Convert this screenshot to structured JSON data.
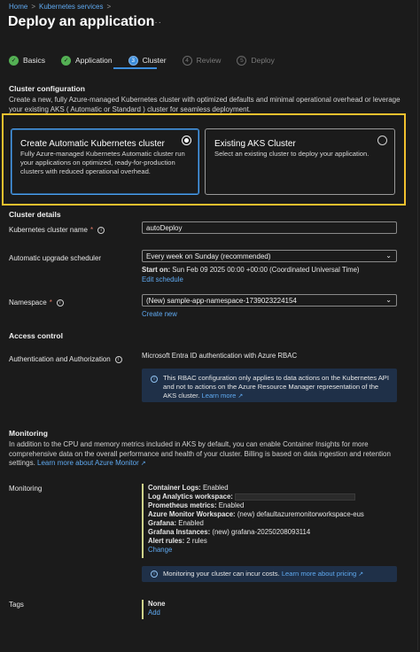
{
  "breadcrumb": {
    "home": "Home",
    "services": "Kubernetes services",
    "sep": ">"
  },
  "title": "Deploy an application",
  "more_icon": "···",
  "steps": [
    {
      "num": "✓",
      "label": "Basics",
      "state": "done"
    },
    {
      "num": "✓",
      "label": "Application",
      "state": "done"
    },
    {
      "num": "3",
      "label": "Cluster",
      "state": "active"
    },
    {
      "num": "4",
      "label": "Review",
      "state": "todo"
    },
    {
      "num": "5",
      "label": "Deploy",
      "state": "todo"
    }
  ],
  "cluster_config": {
    "heading": "Cluster configuration",
    "description": "Create a new, fully Azure-managed Kubernetes cluster with optimized defaults and minimal operational overhead or leverage your existing AKS ( Automatic or Standard ) cluster for seamless deployment.",
    "option_automatic": {
      "title": "Create Automatic Kubernetes cluster",
      "desc": "Fully Azure-managed Kubernetes Automatic cluster run your applications on optimized, ready-for-production clusters with reduced operational overhead."
    },
    "option_existing": {
      "title": "Existing AKS Cluster",
      "desc": "Select an existing cluster to deploy your application."
    }
  },
  "cluster_details": {
    "heading": "Cluster details",
    "name_label": "Kubernetes cluster name",
    "required_mark": "*",
    "name_value": "autoDeploy",
    "upgrade_label": "Automatic upgrade scheduler",
    "upgrade_value": "Every week on Sunday (recommended)",
    "start_on_label": "Start on:",
    "start_on_value": "Sun Feb 09 2025 00:00 +00:00 (Coordinated Universal Time)",
    "edit_schedule": "Edit schedule",
    "namespace_label": "Namespace",
    "namespace_value": "(New) sample-app-namespace-1739023224154",
    "create_new": "Create new"
  },
  "access_control": {
    "heading": "Access control",
    "auth_label": "Authentication and Authorization",
    "auth_value": "Microsoft Entra ID authentication with Azure RBAC",
    "info_text": "This RBAC configuration only applies to data actions on the Kubernetes API and not to actions on the Azure Resource Manager representation of the AKS cluster.",
    "learn_more": "Learn more"
  },
  "monitoring": {
    "heading": "Monitoring",
    "description": "In addition to the CPU and memory metrics included in AKS by default, you can enable Container Insights for more comprehensive data on the overall performance and health of your cluster. Billing is based on data ingestion and retention settings.",
    "learn_more": "Learn more about Azure Monitor",
    "label": "Monitoring",
    "items": [
      {
        "k": "Container Logs:",
        "v": "Enabled"
      },
      {
        "k": "Log Analytics workspace:",
        "v": ""
      },
      {
        "k": "Prometheus metrics:",
        "v": "Enabled"
      },
      {
        "k": "Azure Monitor Workspace:",
        "v": "(new) defaultazuremonitorworkspace-eus"
      },
      {
        "k": "Grafana:",
        "v": "Enabled"
      },
      {
        "k": "Grafana Instances:",
        "v": "(new) grafana-20250208093114"
      },
      {
        "k": "Alert rules:",
        "v": "2 rules"
      }
    ],
    "change": "Change",
    "cost_note": "Monitoring your cluster can incur costs.",
    "cost_link": "Learn more about pricing"
  },
  "tags": {
    "label": "Tags",
    "value": "None",
    "add": "Add"
  },
  "colors": {
    "accent": "#3c8ddb",
    "highlight": "#f2c12e",
    "success": "#54b054",
    "link": "#5fa9f0"
  }
}
